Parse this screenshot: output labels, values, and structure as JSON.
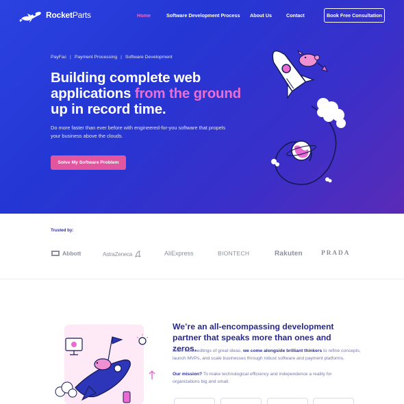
{
  "brand": {
    "name_bold": "Rocket",
    "name_light": "Parts"
  },
  "nav": {
    "items": [
      {
        "label": "Home",
        "active": true
      },
      {
        "label": "Software Development Process",
        "active": false
      },
      {
        "label": "About Us",
        "active": false
      },
      {
        "label": "Contact",
        "active": false
      }
    ],
    "cta": "Book Free Consultation"
  },
  "hero": {
    "breadcrumbs": [
      "PayFac",
      "Payment Processing",
      "Software Development"
    ],
    "breadcrumb_sep": "|",
    "headline_pre": "Building complete web applications ",
    "headline_highlight": "from the ground",
    "headline_post": " up in record time.",
    "lede": "Do more faster than ever before with engineered-for-you software that propels your business above the clouds.",
    "button": "Solve My Software Problem"
  },
  "trusted": {
    "label": "Trusted by:",
    "logos": [
      "Abbott",
      "AstraZeneca",
      "AliExpress",
      "BIONTECH",
      "Rakuten",
      "PRADA"
    ]
  },
  "partner": {
    "headline": "We’re an all-encompassing development partner that speaks more than ones and zeros.",
    "p1_pre": "From the seedlings of great ideas, ",
    "p1_bold": "we come alongside brilliant thinkers",
    "p1_post": " to refine concepts, launch MVPs, and scale businesses through robust software and payment platforms.",
    "p2_bold": "Our mission?",
    "p2_post": " To make technological efficiency and independence a reality for organizations big and small."
  },
  "colors": {
    "hero_gradient_start": "#2b42e0",
    "hero_gradient_end": "#5a2bb6",
    "accent_pink": "#ea6fd3",
    "button_pink": "#e2569f",
    "navy_text": "#27288f"
  }
}
